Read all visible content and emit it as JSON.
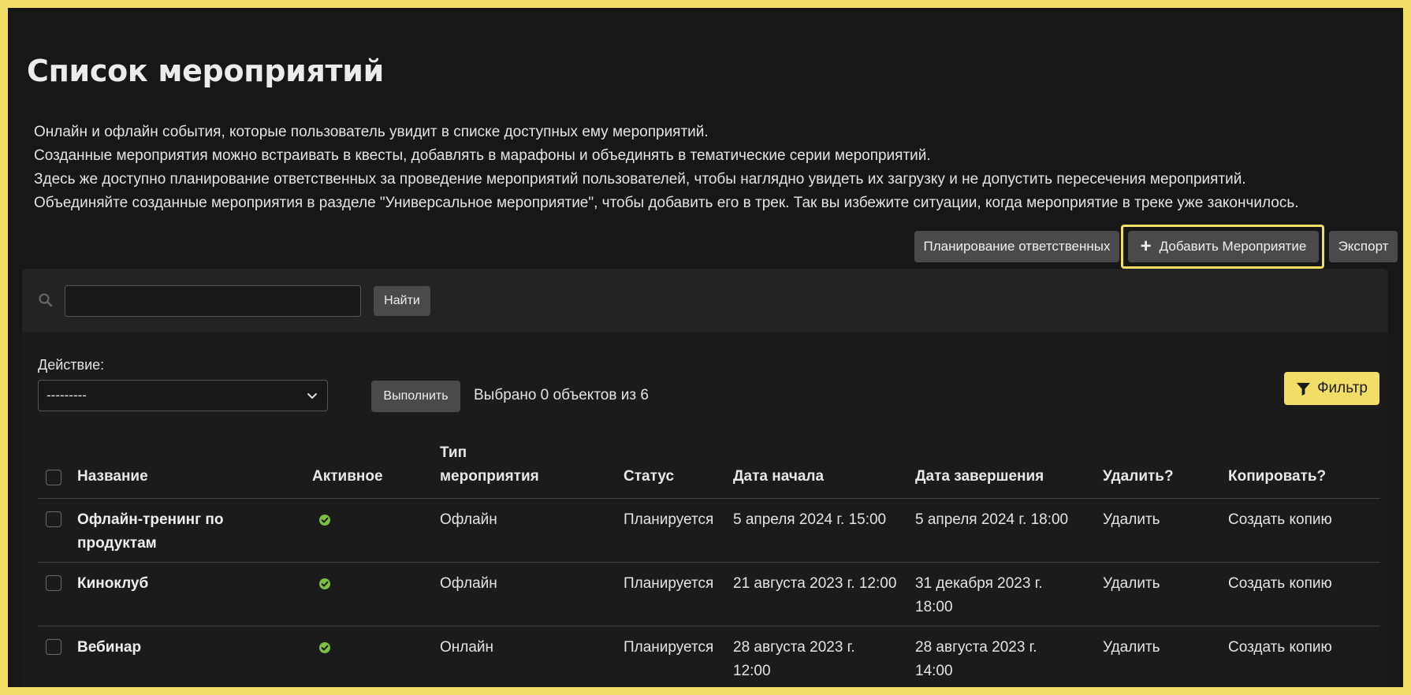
{
  "page": {
    "title": "Список мероприятий",
    "intro": [
      "Онлайн и офлайн события, которые пользователь увидит в списке доступных ему мероприятий.",
      "Созданные мероприятия можно встраивать в квесты, добавлять в марафоны и объединять в тематические серии мероприятий.",
      "Здесь же доступно планирование ответственных за проведение мероприятий пользователей, чтобы наглядно увидеть их загрузку и не допустить пересечения мероприятий.",
      "Объединяйте созданные мероприятия в разделе \"Универсальное мероприятие\", чтобы добавить его в трек. Так вы избежите ситуации, когда мероприятие в треке уже закончилось."
    ]
  },
  "toolbar": {
    "plan_label": "Планирование ответственных",
    "add_label": "Добавить Мероприятие",
    "export_label": "Экспорт"
  },
  "search": {
    "placeholder": "",
    "value": "",
    "button_label": "Найти"
  },
  "actions": {
    "label": "Действие:",
    "selected": "---------",
    "execute_label": "Выполнить",
    "selected_count": "Выбрано 0 объектов из 6",
    "filter_label": "Фильтр"
  },
  "table": {
    "columns": {
      "name": "Название",
      "active": "Активное",
      "type_line1": "Тип",
      "type_line2": "мероприятия",
      "status": "Статус",
      "start": "Дата начала",
      "end": "Дата завершения",
      "delete": "Удалить?",
      "copy": "Копировать?"
    },
    "rows": [
      {
        "name_line1": "Офлайн-тренинг по",
        "name_line2": "продуктам",
        "type": "Офлайн",
        "status": "Планируется",
        "start_line1": "5 апреля 2024 г. 15:00",
        "start_line2": "",
        "end_line1": "5 апреля 2024 г. 18:00",
        "end_line2": "",
        "delete": "Удалить",
        "copy": "Создать копию"
      },
      {
        "name_line1": "Киноклуб",
        "name_line2": "",
        "type": "Офлайн",
        "status": "Планируется",
        "start_line1": "21 августа 2023 г. 12:00",
        "start_line2": "",
        "end_line1": "31 декабря 2023 г.",
        "end_line2": "18:00",
        "delete": "Удалить",
        "copy": "Создать копию"
      },
      {
        "name_line1": "Вебинар",
        "name_line2": "",
        "type": "Онлайн",
        "status": "Планируется",
        "start_line1": "28 августа 2023 г.",
        "start_line2": "12:00",
        "end_line1": "28 августа 2023 г.",
        "end_line2": "14:00",
        "delete": "Удалить",
        "copy": "Создать копию"
      }
    ]
  },
  "colors": {
    "accent": "#f2de66",
    "background": "#171717",
    "active_green": "#7bc043"
  }
}
